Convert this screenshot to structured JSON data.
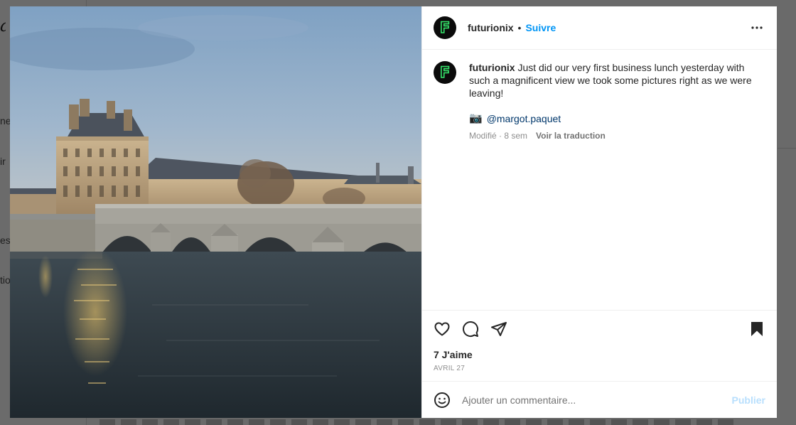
{
  "background": {
    "side_fragments": [
      "ne",
      "ir",
      "es",
      "tio"
    ]
  },
  "post": {
    "username": "futurionix",
    "avatar_letter": "F",
    "separator": "•",
    "follow_label": "Suivre",
    "more_icon": "more-horizontal-icon",
    "caption": {
      "username": "futurionix",
      "text": "Just did our very first business lunch yesterday with such a magnificent view we took some pictures right as we were leaving!",
      "credit_icon": "📷",
      "mention": "@margot.paquet",
      "edited": "Modifié · 8 sem",
      "translate_label": "Voir la traduction"
    },
    "likes": "7 J'aime",
    "date": "AVRIL 27",
    "comment": {
      "placeholder": "Ajouter un commentaire...",
      "publish_label": "Publier"
    }
  },
  "colors": {
    "accent": "#0095f6",
    "publish_disabled": "#b8dffd",
    "avatar_letter": "#35e36a"
  }
}
